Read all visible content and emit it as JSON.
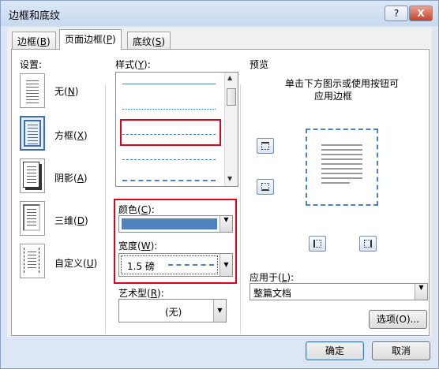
{
  "window": {
    "title": "边框和底纹",
    "help": "?",
    "close": "X"
  },
  "tabs": [
    {
      "label": "边框",
      "key": "B"
    },
    {
      "label": "页面边框",
      "key": "P"
    },
    {
      "label": "底纹",
      "key": "S"
    }
  ],
  "settings": {
    "heading": "设置:",
    "items": [
      {
        "label": "无",
        "key": "N"
      },
      {
        "label": "方框",
        "key": "X"
      },
      {
        "label": "阴影",
        "key": "A"
      },
      {
        "label": "三维",
        "key": "D"
      },
      {
        "label": "自定义",
        "key": "U"
      }
    ],
    "selected": "方框"
  },
  "style": {
    "heading": "样式",
    "key": "Y"
  },
  "color": {
    "label": "颜色",
    "key": "C",
    "value_hex": "#4f81bd"
  },
  "width": {
    "label": "宽度",
    "key": "W",
    "value": "1.5 磅"
  },
  "art": {
    "label": "艺术型",
    "key": "R",
    "value": "(无)"
  },
  "preview": {
    "heading": "预览",
    "hint_line1": "单击下方图示或使用按钮可",
    "hint_line2": "应用边框"
  },
  "apply": {
    "label": "应用于",
    "key": "L",
    "value": "整篇文档"
  },
  "buttons": {
    "options": "选项(O)...",
    "ok": "确定",
    "cancel": "取消"
  },
  "colors": {
    "highlight": "#e0001b",
    "accent": "#4f81bd",
    "preview_border": "#4f81bd"
  }
}
